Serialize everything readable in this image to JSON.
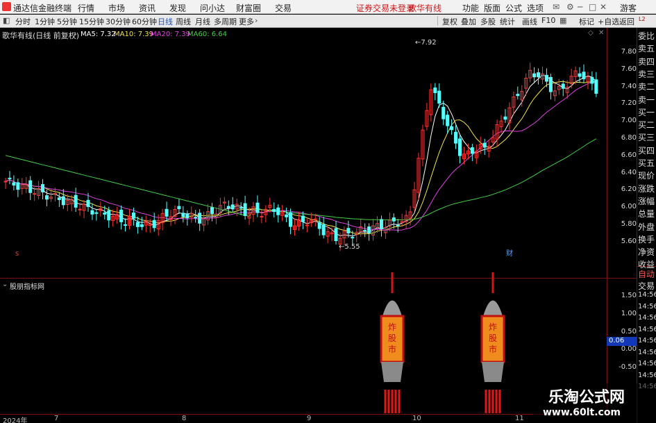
{
  "menu": {
    "app_title": "通达信金融终端",
    "items": [
      "行情",
      "市场",
      "资讯",
      "发现",
      "问小达",
      "财富圈",
      "交易"
    ],
    "status": "证券交易未登录",
    "stock_tab": "歌华有线",
    "right_items": [
      "功能",
      "版面",
      "公式",
      "选项"
    ],
    "user": "游客"
  },
  "toolbar": {
    "periods": [
      "分时",
      "1分钟",
      "5分钟",
      "15分钟",
      "30分钟",
      "60分钟",
      "日线",
      "周线",
      "月线",
      "多周期",
      "更多"
    ],
    "selected": "日线",
    "right": [
      "复权",
      "叠加",
      "多股",
      "统计",
      "画线",
      "F10",
      "标记",
      "+自选",
      "返回"
    ]
  },
  "main_chart": {
    "title": "歌华有线(日线 前复权)",
    "legend": [
      {
        "label": "MA5: 7.32",
        "color": "#ffffff"
      },
      {
        "label": "MA10: 7.39",
        "color": "#f4e542"
      },
      {
        "label": "MA20: 7.39",
        "color": "#e040e0"
      },
      {
        "label": "MA60: 6.64",
        "color": "#40d040"
      }
    ],
    "high_label": "7.92",
    "low_label": "5.55",
    "marker": "财",
    "marker_left": "S"
  },
  "indicator": {
    "title": "股朋指标网",
    "value_box": "0.06",
    "rocket_text": [
      "炸",
      "股",
      "市"
    ]
  },
  "chart_data": [
    {
      "type": "candlestick",
      "title": "歌华有线(日线 前复权)",
      "ylim": [
        5.45,
        8.0
      ],
      "y_ticks": [
        "7.80",
        "7.60",
        "7.40",
        "7.20",
        "7.00",
        "6.80",
        "6.60",
        "6.40",
        "6.20",
        "6.00",
        "5.80",
        "5.60"
      ],
      "x_labels": [
        "2024年",
        "7",
        "8",
        "9",
        "10",
        "11"
      ],
      "series": [
        {
          "name": "MA5",
          "values": [
            7.32
          ]
        },
        {
          "name": "MA10",
          "values": [
            7.39
          ]
        },
        {
          "name": "MA20",
          "values": [
            7.39
          ]
        },
        {
          "name": "MA60",
          "values": [
            6.64
          ]
        }
      ],
      "annotations": [
        {
          "label": "7.92",
          "value": 7.92
        },
        {
          "label": "5.55",
          "value": 5.55
        }
      ]
    },
    {
      "type": "indicator",
      "title": "股朋指标网",
      "y_ticks": [
        "1.50",
        "1.00",
        "0.50",
        "0.00",
        "-0.50"
      ],
      "ylim": [
        -0.6,
        1.75
      ],
      "current": 0.06
    }
  ],
  "right_panel": {
    "rows": [
      "委比",
      "卖五",
      "卖四",
      "卖三",
      "卖二",
      "卖一",
      "买一",
      "买二",
      "买三",
      "买四",
      "买五",
      "现价",
      "涨跌",
      "涨幅",
      "总量",
      "外盘",
      "换手",
      "净资",
      "收益"
    ],
    "lower": [
      "自动",
      "交易",
      "14:56",
      "14:56",
      "14:56",
      "14:56",
      "14:56",
      "14:56",
      "14:56",
      "14:56",
      "14:56"
    ]
  },
  "watermark": {
    "title": "乐淘公式网",
    "url": "www.60lt.com"
  }
}
